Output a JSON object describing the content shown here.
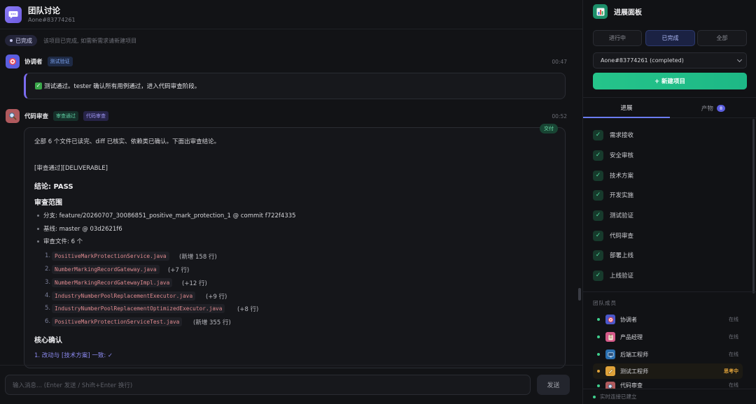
{
  "header": {
    "title": "团队讨论",
    "subtitle": "Aone#83774261"
  },
  "status": {
    "badge": "已完成",
    "note": "该项目已完成, 如需新需求请新建项目"
  },
  "messages": [
    {
      "sender": "协调者",
      "tags": [
        "测试验证"
      ],
      "time": "00:47",
      "text": "测试通过。tester 确认所有用例通过，进入代码审查阶段。"
    },
    {
      "sender": "代码审查",
      "tags": [
        "审查通过",
        "代码审查"
      ],
      "time": "00:52",
      "badge": "交付",
      "intro": "全部 6 个文件已读完、diff 已核实、依赖类已确认。下面出审查结论。",
      "marker": "[审查通过][DELIVERABLE]",
      "conclusion": "结论: PASS",
      "scope_heading": "审查范围",
      "scope": [
        "分支: feature/20260707_30086851_positive_mark_protection_1 @ commit f722f4335",
        "基线: master @ 03d2621f6",
        "审查文件: 6 个"
      ],
      "files": [
        {
          "num": "1.",
          "name": "PositiveMarkProtectionService.java",
          "note": "(新增 158 行)"
        },
        {
          "num": "2.",
          "name": "NumberMarkingRecordGateway.java",
          "note": "(+7 行)"
        },
        {
          "num": "3.",
          "name": "NumberMarkingRecordGatewayImpl.java",
          "note": "(+12 行)"
        },
        {
          "num": "4.",
          "name": "IndustryNumberPoolReplacementExecutor.java",
          "note": "(+9 行)"
        },
        {
          "num": "5.",
          "name": "IndustryNumberPoolReplacementOptimizedExecutor.java",
          "note": "(+8 行)"
        },
        {
          "num": "6.",
          "name": "PositiveMarkProtectionServiceTest.java",
          "note": "(新增 355 行)"
        }
      ],
      "core_heading": "核心确认",
      "core_first": "1. 改动与 [技术方案] 一致: ✓"
    }
  ],
  "input": {
    "placeholder": "输入消息... (Enter 发送 / Shift+Enter 换行)",
    "send_label": "发送"
  },
  "panel": {
    "title": "进展面板",
    "filters": [
      "进行中",
      "已完成",
      "全部"
    ],
    "selected_project": "Aone#83774261 (completed)",
    "new_project": "+ 新建项目",
    "tabs": {
      "progress": "进展",
      "artifacts": "产物",
      "artifact_count": "8"
    },
    "steps": [
      "需求接收",
      "安全审核",
      "技术方案",
      "开发实施",
      "测试验证",
      "代码审查",
      "部署上线",
      "上线验证"
    ],
    "team_title": "团队成员",
    "members": [
      {
        "name": "协调者",
        "status": "在线",
        "icon": "target-icon"
      },
      {
        "name": "产品经理",
        "status": "在线",
        "icon": "clipboard-icon"
      },
      {
        "name": "后端工程师",
        "status": "在线",
        "icon": "computer-icon"
      },
      {
        "name": "测试工程师",
        "status": "思考中",
        "icon": "pencil-icon"
      },
      {
        "name": "代码审查",
        "status": "在线",
        "icon": "magnifier-icon"
      }
    ],
    "connection": "实时连接已建立"
  }
}
